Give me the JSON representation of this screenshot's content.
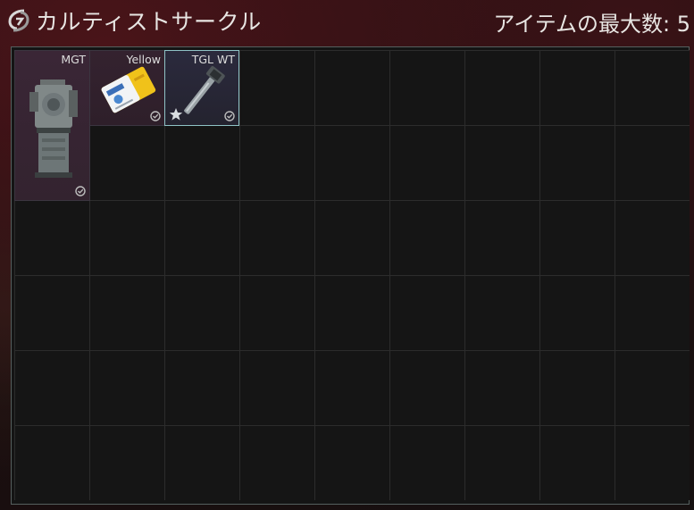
{
  "header": {
    "title": "カルティストサークル",
    "max_items": "アイテムの最大数: 5"
  },
  "items": [
    {
      "label": "MGT",
      "checked": true
    },
    {
      "label": "Yellow",
      "checked": true
    },
    {
      "label": "TGL WT",
      "checked": true,
      "favorite": true,
      "selected": true
    }
  ],
  "colors": {
    "accent_selected_border": "#8fc3c6",
    "item_background": "#3a2636"
  }
}
